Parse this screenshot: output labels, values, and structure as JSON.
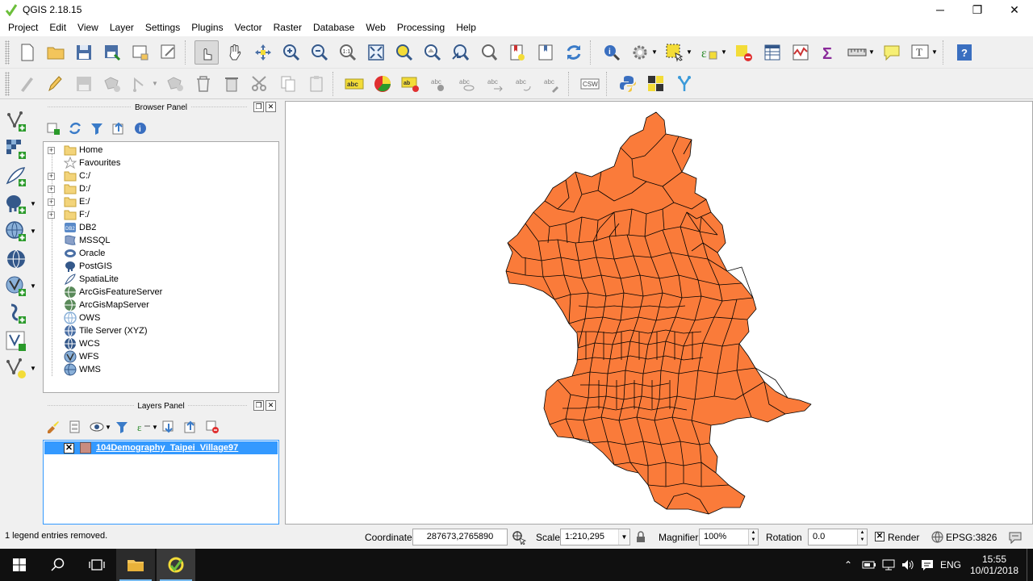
{
  "window": {
    "title": "QGIS 2.18.15",
    "controls": [
      "minimize",
      "maximize",
      "close"
    ]
  },
  "menu": [
    "Project",
    "Edit",
    "View",
    "Layer",
    "Settings",
    "Plugins",
    "Vector",
    "Raster",
    "Database",
    "Web",
    "Processing",
    "Help"
  ],
  "browser_panel": {
    "title": "Browser Panel",
    "items": [
      {
        "label": "Home",
        "icon": "folder-icon",
        "expandable": true
      },
      {
        "label": "Favourites",
        "icon": "star-icon",
        "expandable": false
      },
      {
        "label": "C:/",
        "icon": "folder-icon",
        "expandable": true
      },
      {
        "label": "D:/",
        "icon": "folder-icon",
        "expandable": true
      },
      {
        "label": "E:/",
        "icon": "folder-icon",
        "expandable": true
      },
      {
        "label": "F:/",
        "icon": "folder-icon",
        "expandable": true
      },
      {
        "label": "DB2",
        "icon": "db2-icon",
        "expandable": false
      },
      {
        "label": "MSSQL",
        "icon": "mssql-icon",
        "expandable": false
      },
      {
        "label": "Oracle",
        "icon": "oracle-icon",
        "expandable": false
      },
      {
        "label": "PostGIS",
        "icon": "postgis-icon",
        "expandable": false
      },
      {
        "label": "SpatiaLite",
        "icon": "spatialite-icon",
        "expandable": false
      },
      {
        "label": "ArcGisFeatureServer",
        "icon": "arcgis-feature-icon",
        "expandable": false
      },
      {
        "label": "ArcGisMapServer",
        "icon": "arcgis-map-icon",
        "expandable": false
      },
      {
        "label": "OWS",
        "icon": "ows-icon",
        "expandable": false
      },
      {
        "label": "Tile Server (XYZ)",
        "icon": "xyz-icon",
        "expandable": false
      },
      {
        "label": "WCS",
        "icon": "wcs-icon",
        "expandable": false
      },
      {
        "label": "WFS",
        "icon": "wfs-icon",
        "expandable": false
      },
      {
        "label": "WMS",
        "icon": "wms-icon",
        "expandable": false
      }
    ]
  },
  "layers_panel": {
    "title": "Layers Panel",
    "layers": [
      {
        "name": "104Demography_Taipei_Village97",
        "checked": true,
        "swatch_color": "#c98c80",
        "selected": true
      }
    ]
  },
  "map": {
    "fill_color": "#fa7b3a",
    "stroke_color": "#000000"
  },
  "statusbar": {
    "message": "1 legend entries removed.",
    "coordinate_label": "Coordinate",
    "coordinate_value": "287673,2765890",
    "scale_label": "Scale",
    "scale_value": "1:210,295",
    "magnifier_label": "Magnifier",
    "magnifier_value": "100%",
    "rotation_label": "Rotation",
    "rotation_value": "0.0",
    "render_label": "Render",
    "render_checked": true,
    "crs": "EPSG:3826"
  },
  "taskbar": {
    "language": "ENG",
    "time": "15:55",
    "date": "10/01/2018"
  }
}
